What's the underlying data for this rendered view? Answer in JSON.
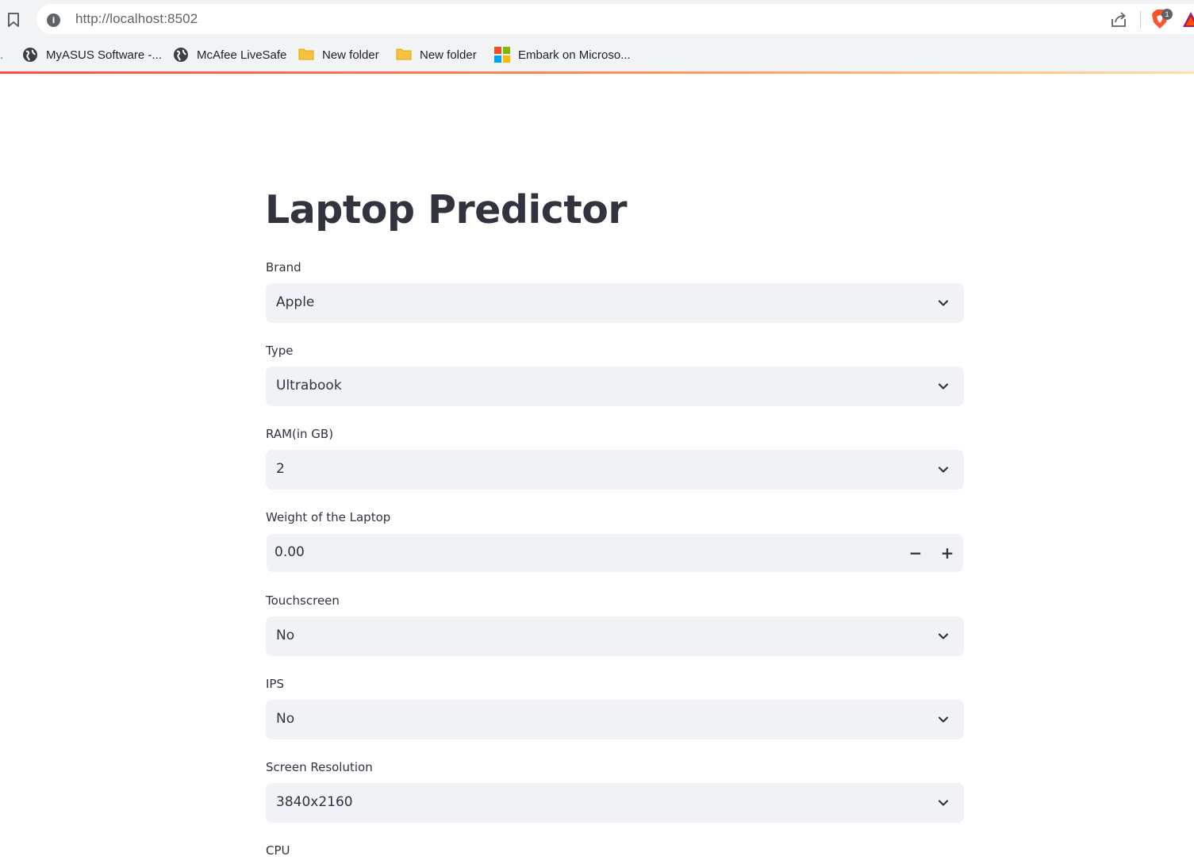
{
  "browser": {
    "url": "http://localhost:8502",
    "bookmarks": [
      {
        "label": "MyASUS Software -...",
        "icon": "globe-icon"
      },
      {
        "label": "McAfee LiveSafe",
        "icon": "globe-icon"
      },
      {
        "label": "New folder",
        "icon": "folder-icon"
      },
      {
        "label": "New folder",
        "icon": "folder-icon"
      },
      {
        "label": "Embark on Microso...",
        "icon": "microsoft-icon"
      }
    ],
    "brave_badge_count": "1"
  },
  "app": {
    "title": "Laptop Predictor",
    "fields": {
      "brand": {
        "label": "Brand",
        "value": "Apple"
      },
      "type": {
        "label": "Type",
        "value": "Ultrabook"
      },
      "ram": {
        "label": "RAM(in GB)",
        "value": "2"
      },
      "weight": {
        "label": "Weight of the Laptop",
        "value": "0.00",
        "decrement": "−",
        "increment": "+"
      },
      "touchscreen": {
        "label": "Touchscreen",
        "value": "No"
      },
      "ips": {
        "label": "IPS",
        "value": "No"
      },
      "resolution": {
        "label": "Screen Resolution",
        "value": "3840x2160"
      },
      "cpu": {
        "label": "CPU"
      }
    }
  },
  "colors": {
    "accent_gradient_start": "#ff4b4b",
    "accent_gradient_end": "#ffe0a0",
    "input_bg": "#f0f2f6",
    "text": "#31333f"
  }
}
